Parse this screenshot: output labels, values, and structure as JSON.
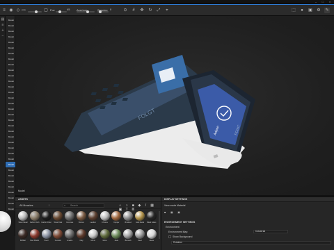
{
  "toolbar": {
    "fov_label": "Fov",
    "fov_value": "45",
    "focus_label": "Focus",
    "focus_value": "1",
    "aperture_label": "Aperture",
    "spacing_label": "Spacing",
    "spacing_value": "0"
  },
  "material_tag": "Material",
  "scene_list": {
    "items": [
      "Model",
      "Model",
      "Model",
      "Model",
      "Model",
      "Model",
      "Model",
      "Model",
      "Model",
      "Model",
      "Model",
      "Model",
      "Model",
      "Model",
      "Model",
      "Model",
      "Model",
      "Model",
      "Model",
      "Model",
      "Model",
      "Model",
      "Model",
      "Model",
      "Model",
      "Model",
      "Model",
      "Model",
      "Model",
      "Model",
      "Model",
      "Model",
      "Model",
      "Model",
      "Model"
    ],
    "selected_index": 26
  },
  "viewport": {
    "label": "Model",
    "screen_brand": "Adyen",
    "card_brand": "Paypal",
    "side_text": "POINT",
    "keypad_text": "FOLGT"
  },
  "assets": {
    "title": "ASSETS",
    "library": "All libraries",
    "search_placeholder": "Search",
    "materials": [
      {
        "label": "Silver Metal",
        "color": "#b9b9b9",
        "style": "metal"
      },
      {
        "label": "Fabric Cloth",
        "color": "#8a7d6a",
        "style": "matte"
      },
      {
        "label": "Carbon Fiber",
        "color": "#1e1e1e",
        "style": "dark"
      },
      {
        "label": "Wood Oak",
        "color": "#6a4a32",
        "style": "matte"
      },
      {
        "label": "Concrete",
        "color": "#6d6d6d",
        "style": "matte"
      },
      {
        "label": "Bronze",
        "color": "#7a5a43",
        "style": "metal"
      },
      {
        "label": "Leather",
        "color": "#5b3f30",
        "style": "matte"
      },
      {
        "label": "Chrome",
        "color": "#bcbcbc",
        "style": "metal"
      },
      {
        "label": "Copper",
        "color": "#a0683f",
        "style": "metal"
      },
      {
        "label": "Brushed",
        "color": "#8f8f8f",
        "style": "metal"
      },
      {
        "label": "Gold Metal",
        "color": "#b1924a",
        "style": "metal"
      },
      {
        "label": "Black Glass",
        "color": "#262626",
        "style": "dark"
      },
      {
        "label": "Rubber",
        "color": "#3a2a25",
        "style": "dark"
      },
      {
        "label": "Red Plastic",
        "color": "#8a3a2e",
        "style": "glossy"
      },
      {
        "label": "Pearl",
        "color": "#8b93a4",
        "style": "glossy"
      },
      {
        "label": "Ceramic",
        "color": "#7e4a36",
        "style": "matte"
      },
      {
        "label": "Granite",
        "color": "#6b6b6b",
        "style": "matte"
      },
      {
        "label": "Clay",
        "color": "#5d3a2c",
        "style": "matte"
      },
      {
        "label": "Mirror",
        "color": "#c7c7c7",
        "style": "metal"
      },
      {
        "label": "Moss",
        "color": "#5e6a3b",
        "style": "matte"
      },
      {
        "label": "Jade",
        "color": "#6c8a5a",
        "style": "glossy"
      },
      {
        "label": "Bismuth",
        "color": "#a3a3a3",
        "style": "metal"
      },
      {
        "label": "Steel",
        "color": "#9a9a9a",
        "style": "metal"
      },
      {
        "label": "Glass",
        "color": "#d7d7d7",
        "style": "glossy"
      }
    ]
  },
  "display": {
    "title": "DISPLAY SETTINGS",
    "view_mode_label": "View mode",
    "view_mode_value": "Material",
    "env_title": "ENVIRONMENT SETTINGS",
    "environment_label": "Environment",
    "env_map_label": "Environment Map",
    "env_map_value": "Industrial",
    "env_background_label": "Show Background",
    "env_rotation_label": "Rotation"
  }
}
